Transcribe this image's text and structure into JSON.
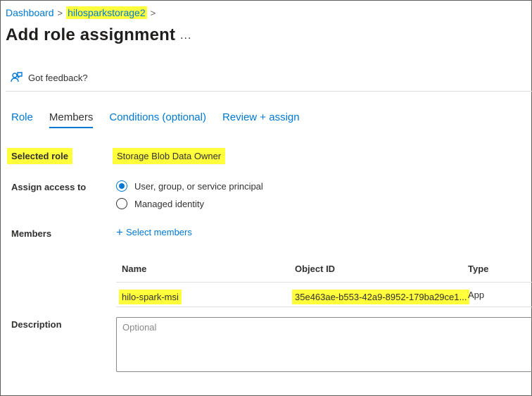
{
  "breadcrumb": {
    "dashboard": "Dashboard",
    "current": "hilosparkstorage2",
    "sep": ">"
  },
  "header": {
    "title": "Add role assignment",
    "more": "..."
  },
  "feedback": {
    "label": "Got feedback?"
  },
  "tabs": [
    {
      "label": "Role",
      "active": false
    },
    {
      "label": "Members",
      "active": true
    },
    {
      "label": "Conditions (optional)",
      "active": false
    },
    {
      "label": "Review + assign",
      "active": false
    }
  ],
  "form": {
    "selected_role_label": "Selected role",
    "selected_role_value": "Storage Blob Data Owner",
    "assign_access_label": "Assign access to",
    "assign_options": [
      {
        "label": "User, group, or service principal",
        "checked": true
      },
      {
        "label": "Managed identity",
        "checked": false
      }
    ],
    "members_label": "Members",
    "select_members": "Select members",
    "description_label": "Description",
    "description_placeholder": "Optional"
  },
  "members_table": {
    "columns": [
      "Name",
      "Object ID",
      "Type"
    ],
    "rows": [
      {
        "name": "hilo-spark-msi",
        "object_id": "35e463ae-b553-42a9-8952-179ba29ce1...",
        "type": "App"
      }
    ]
  },
  "colors": {
    "accent": "#0078d4",
    "highlight": "#ffff3b",
    "text": "#323130"
  }
}
